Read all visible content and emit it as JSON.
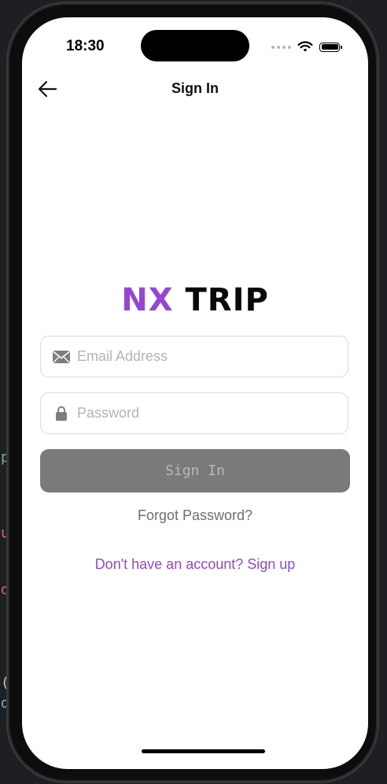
{
  "status_bar": {
    "time": "18:30",
    "icons": [
      "signal-dots-icon",
      "wifi-icon",
      "battery-icon"
    ]
  },
  "nav": {
    "title": "Sign In",
    "back_icon": "arrow-left-icon"
  },
  "logo": {
    "part1": "NX",
    "part2": "TRIP",
    "accent_color": "#9646d2"
  },
  "form": {
    "email": {
      "placeholder": "Email Address",
      "value": "",
      "icon": "envelope-icon"
    },
    "password": {
      "placeholder": "Password",
      "value": "",
      "icon": "lock-icon"
    },
    "submit_label": "Sign In",
    "submit_color": "#7a7a7a"
  },
  "links": {
    "forgot": "Forgot Password?",
    "signup": "Don't have an account? Sign up"
  },
  "background_editor": {
    "glyphs": [
      "p",
      "u",
      "d",
      "(",
      "d"
    ]
  }
}
